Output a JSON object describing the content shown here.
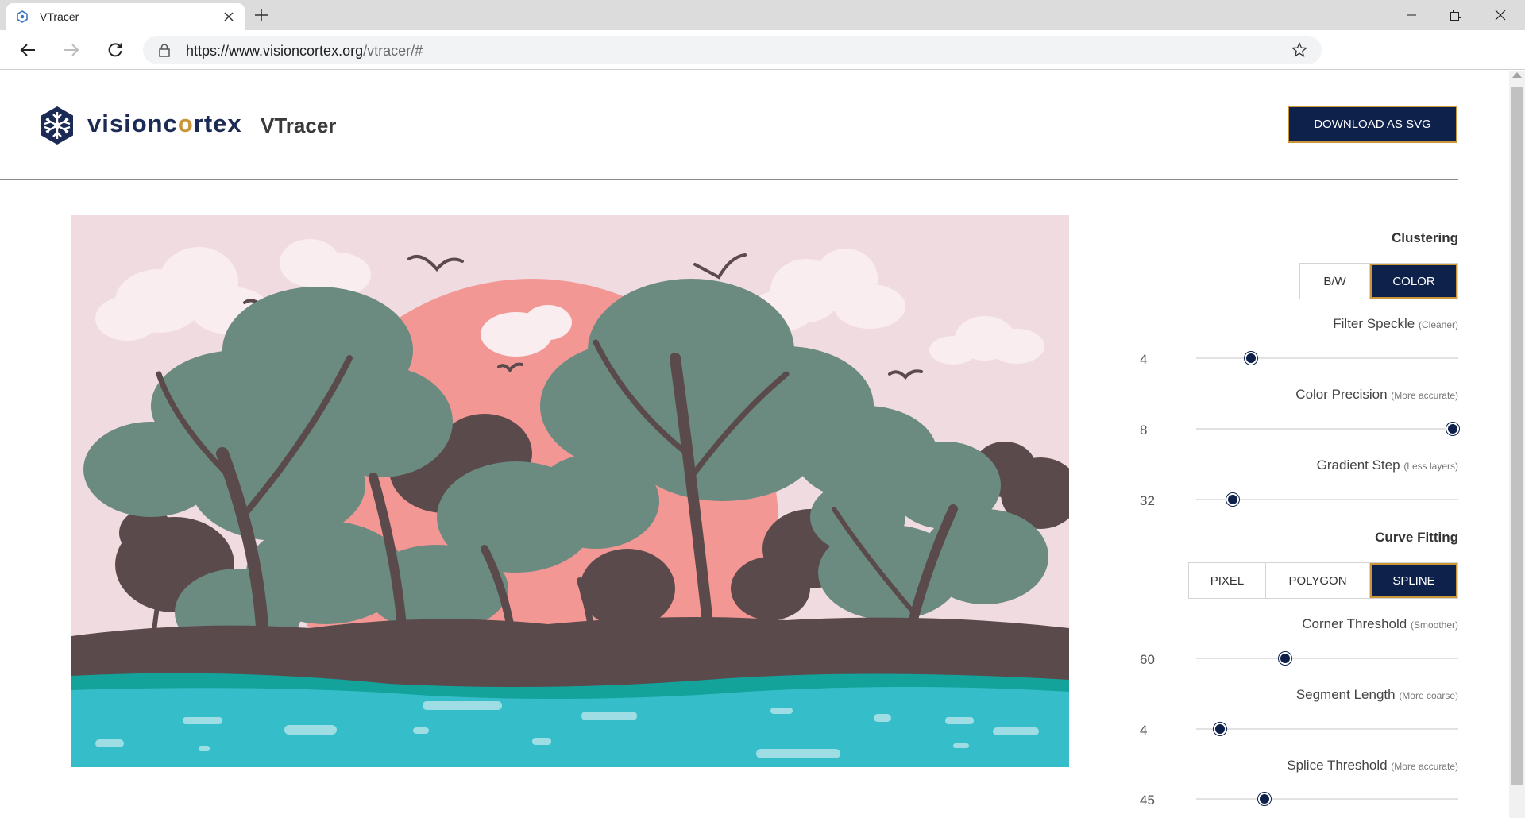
{
  "browser": {
    "tab_title": "VTracer",
    "url_host": "https://www.visioncortex.org",
    "url_path": "/vtracer/#"
  },
  "header": {
    "brand_prefix": "visionc",
    "brand_o": "o",
    "brand_suffix": "rtex",
    "app_title": "VTracer",
    "download_label": "DOWNLOAD AS SVG"
  },
  "clustering": {
    "title": "Clustering",
    "options": [
      "B/W",
      "COLOR"
    ],
    "selected": "COLOR",
    "params": [
      {
        "label": "Filter Speckle",
        "hint": "(Cleaner)",
        "value": "4",
        "fraction": 0.21
      },
      {
        "label": "Color Precision",
        "hint": "(More accurate)",
        "value": "8",
        "fraction": 0.98
      },
      {
        "label": "Gradient Step",
        "hint": "(Less layers)",
        "value": "32",
        "fraction": 0.14
      }
    ]
  },
  "curve_fitting": {
    "title": "Curve Fitting",
    "options": [
      "PIXEL",
      "POLYGON",
      "SPLINE"
    ],
    "selected": "SPLINE",
    "params": [
      {
        "label": "Corner Threshold",
        "hint": "(Smoother)",
        "value": "60",
        "fraction": 0.34
      },
      {
        "label": "Segment Length",
        "hint": "(More coarse)",
        "value": "4",
        "fraction": 0.09
      },
      {
        "label": "Splice Threshold",
        "hint": "(More accurate)",
        "value": "45",
        "fraction": 0.26
      }
    ]
  },
  "colors": {
    "navy": "#0e214b",
    "gold": "#c9973a",
    "sky": "#f0dbe0",
    "sun": "#f29794",
    "tree": "#6b8a80",
    "trunk": "#5a4a4c",
    "water": "#35bec9"
  }
}
